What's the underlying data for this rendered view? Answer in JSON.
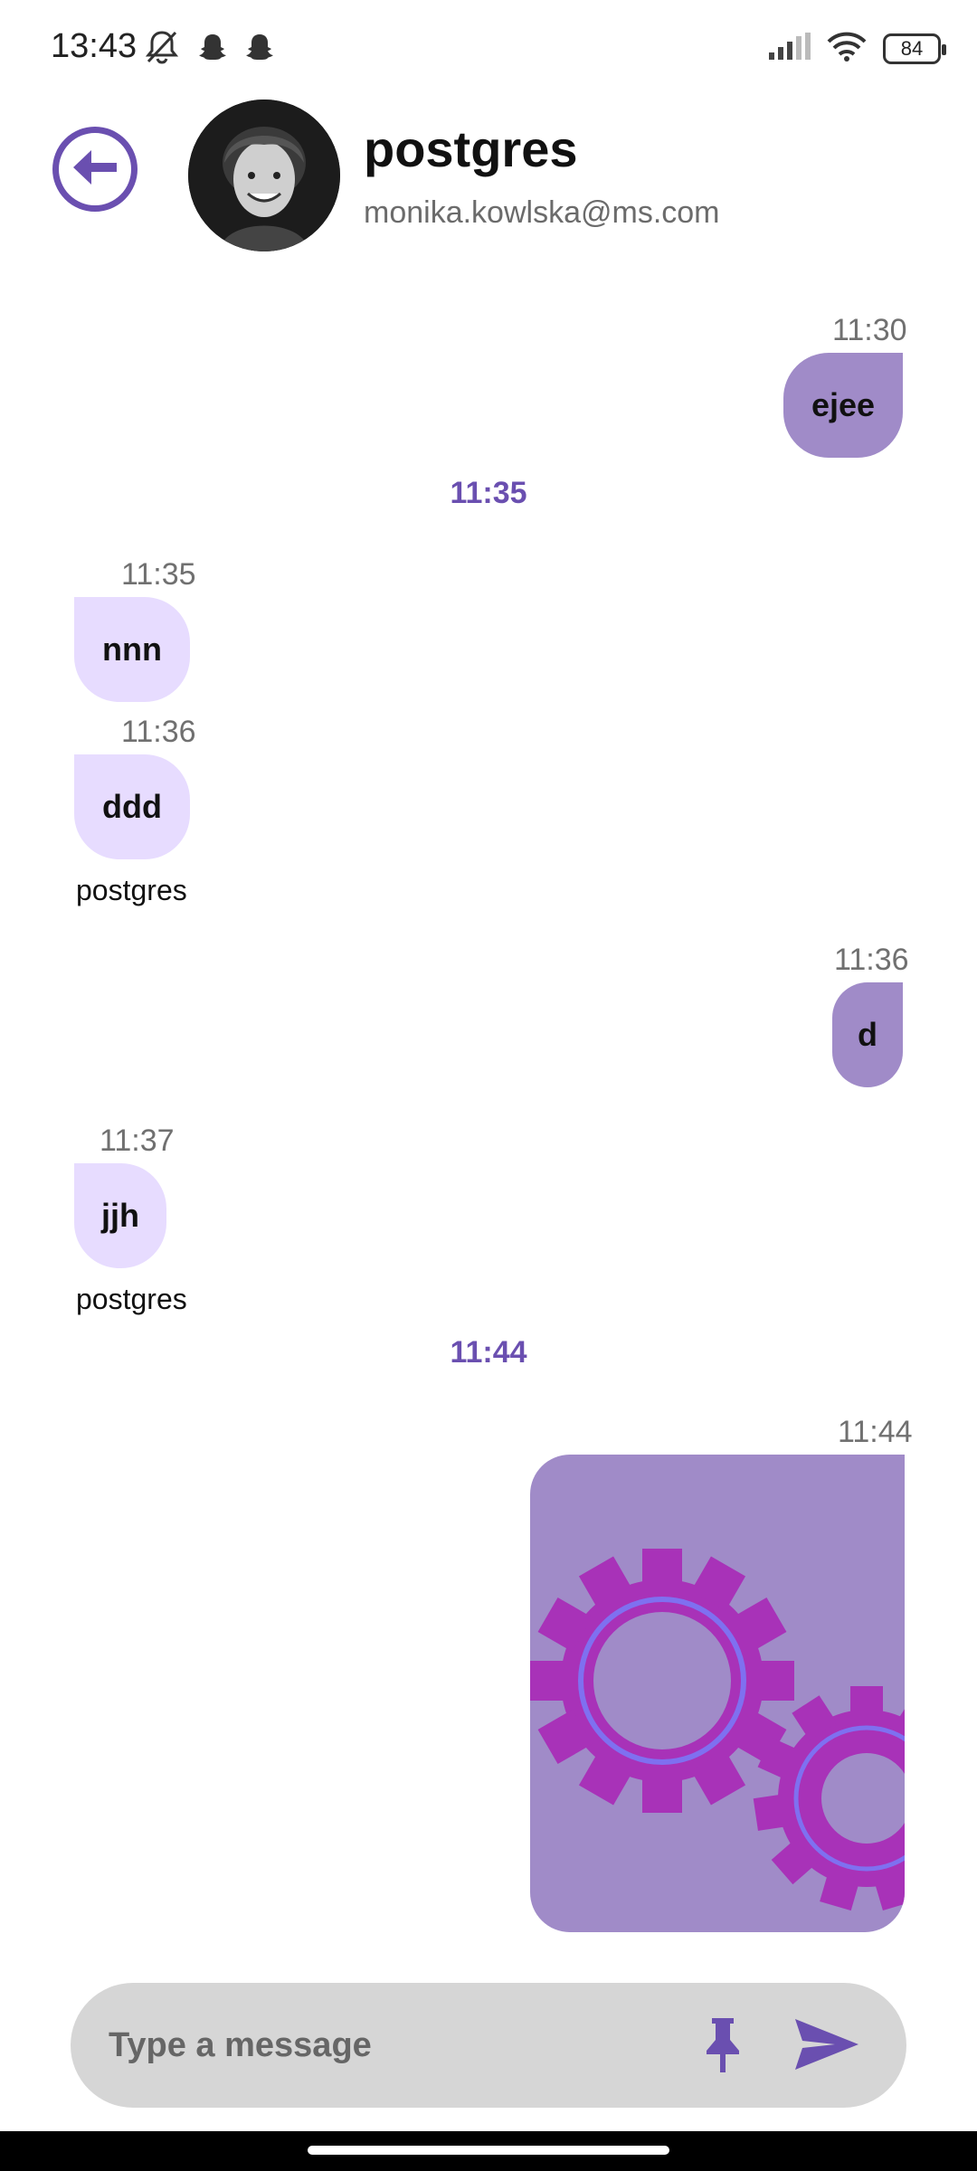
{
  "status_bar": {
    "time": "13:43",
    "battery": "84",
    "icons_left": [
      "mute-alarm-icon",
      "snapchat-icon",
      "snapchat-icon"
    ],
    "icons_right": [
      "signal-icon",
      "wifi-icon",
      "battery-icon"
    ]
  },
  "header": {
    "name": "postgres",
    "email": "monika.kowlska@ms.com",
    "back_icon": "arrow-left-circle-icon"
  },
  "messages": [
    {
      "direction": "out",
      "time": "11:30",
      "text": "ejee"
    },
    {
      "separator": "11:35"
    },
    {
      "direction": "in",
      "time": "11:35",
      "text": "nnn"
    },
    {
      "direction": "in",
      "time": "11:36",
      "text": "ddd",
      "sender": "postgres"
    },
    {
      "direction": "out",
      "time": "11:36",
      "text": "d"
    },
    {
      "direction": "in",
      "time": "11:37",
      "text": "jjh",
      "sender": "postgres"
    },
    {
      "separator": "11:44"
    },
    {
      "direction": "out",
      "time": "11:44",
      "type": "image",
      "image": "gears-image"
    }
  ],
  "input": {
    "placeholder": "Type a message",
    "pin_icon": "pin-icon",
    "send_icon": "send-icon"
  },
  "colors": {
    "accent": "#6a4fb0",
    "outgoing_bubble": "#a08bc8",
    "incoming_bubble": "#e7dcff",
    "input_bg": "#d6d6d6"
  }
}
